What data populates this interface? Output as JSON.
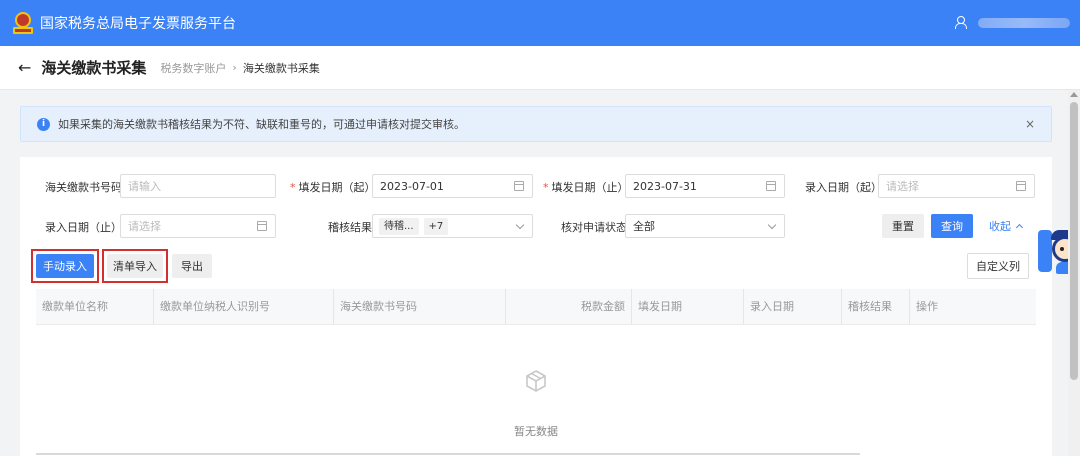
{
  "header": {
    "app_title": "国家税务总局电子发票服务平台"
  },
  "titlebar": {
    "back_icon": "←",
    "page_title": "海关缴款书采集",
    "breadcrumb": [
      "税务数字账户",
      "海关缴款书采集"
    ],
    "breadcrumb_sep": "›"
  },
  "alert": {
    "text": "如果采集的海关缴款书稽核结果为不符、缺联和重号的，可通过申请核对提交审核。",
    "close": "×"
  },
  "filters": {
    "customs_no": {
      "label": "海关缴款书号码",
      "placeholder": "请输入"
    },
    "issue_date_start": {
      "label": "填发日期（起）",
      "value": "2023-07-01"
    },
    "issue_date_end": {
      "label": "填发日期（止）",
      "value": "2023-07-31"
    },
    "entry_date_start": {
      "label": "录入日期（起）",
      "placeholder": "请选择"
    },
    "entry_date_end": {
      "label": "录入日期（止）",
      "placeholder": "请选择"
    },
    "audit_result": {
      "label": "稽核结果",
      "tags": [
        "待稽...",
        "+7"
      ]
    },
    "verify_status": {
      "label": "核对申请状态",
      "value": "全部"
    }
  },
  "actions": {
    "reset": "重置",
    "query": "查询",
    "collapse": "收起",
    "manual_entry": "手动录入",
    "list_import": "清单导入",
    "export": "导出",
    "custom_columns": "自定义列"
  },
  "table": {
    "columns": [
      "缴款单位名称",
      "缴款单位纳税人识别号",
      "海关缴款书号码",
      "税款金额",
      "填发日期",
      "录入日期",
      "稽核结果",
      "操作"
    ],
    "rows": [],
    "empty_text": "暂无数据"
  },
  "colors": {
    "primary": "#3b82f6",
    "highlight": "#d32f2f",
    "required": "#e74c3c"
  },
  "icons": {
    "user": "user-icon",
    "info": "info-icon",
    "calendar": "calendar-icon",
    "empty": "empty-box-icon",
    "assistant": "assistant-avatar-icon"
  }
}
